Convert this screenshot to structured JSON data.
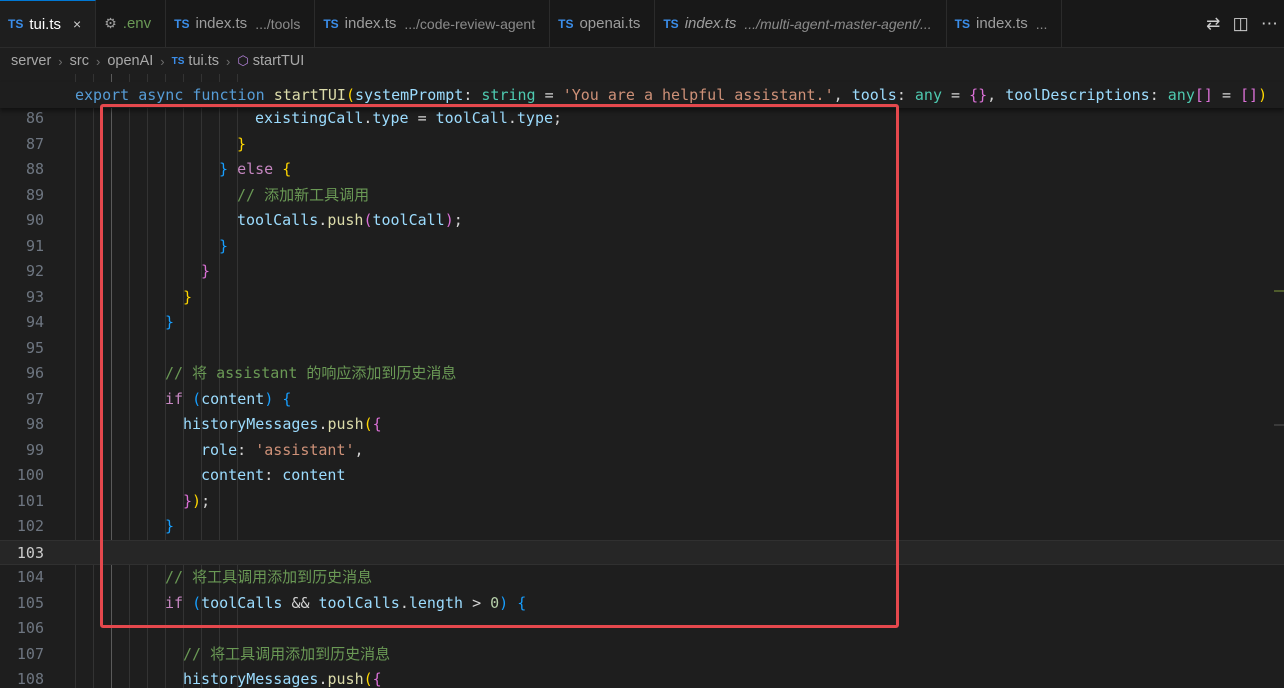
{
  "tabs": [
    {
      "badge": "TS",
      "name": "tui.ts",
      "path": "",
      "active": true,
      "close": "×"
    },
    {
      "badge": "⚙",
      "name": ".env",
      "path": "",
      "active": false
    },
    {
      "badge": "TS",
      "name": "index.ts",
      "path": ".../tools",
      "active": false
    },
    {
      "badge": "TS",
      "name": "index.ts",
      "path": ".../code-review-agent",
      "active": false
    },
    {
      "badge": "TS",
      "name": "openai.ts",
      "path": "",
      "active": false
    },
    {
      "badge": "TS",
      "name": "index.ts",
      "path": ".../multi-agent-master-agent/...",
      "active": false
    },
    {
      "badge": "TS",
      "name": "index.ts",
      "path": "...",
      "active": false
    }
  ],
  "breadcrumb": {
    "items": [
      "server",
      "src",
      "openAI",
      "tui.ts",
      "startTUI"
    ],
    "ts_badge": "TS",
    "symbol_icon": "⬡"
  },
  "editor": {
    "sticky_line": "export async function startTUI(systemPrompt: string = 'You are a helpful assistant.', tools: any = {}, toolDescriptions: any[] = [])",
    "line_numbers": [
      "86",
      "87",
      "88",
      "89",
      "90",
      "91",
      "92",
      "93",
      "94",
      "95",
      "96",
      "97",
      "98",
      "99",
      "100",
      "101",
      "102",
      "103",
      "104",
      "105",
      "106",
      "107",
      "108"
    ],
    "current_line": "103",
    "comments": {
      "add_new_tool": "// 添加新工具调用",
      "add_assistant": "// 将 assistant 的响应添加到历史消息",
      "add_tool_calls": "// 将工具调用添加到历史消息",
      "add_tool_calls_2": "// 将工具调用添加到历史消息"
    },
    "strings": {
      "default_prompt": "'You are a helpful assistant.'",
      "role_value": "'assistant'"
    },
    "numbers": {
      "zero": "0"
    }
  },
  "annotation": {
    "color": "#e5484d"
  },
  "colors": {
    "tab_accent": "#0078d4",
    "ts_badge": "#3b8eea"
  }
}
